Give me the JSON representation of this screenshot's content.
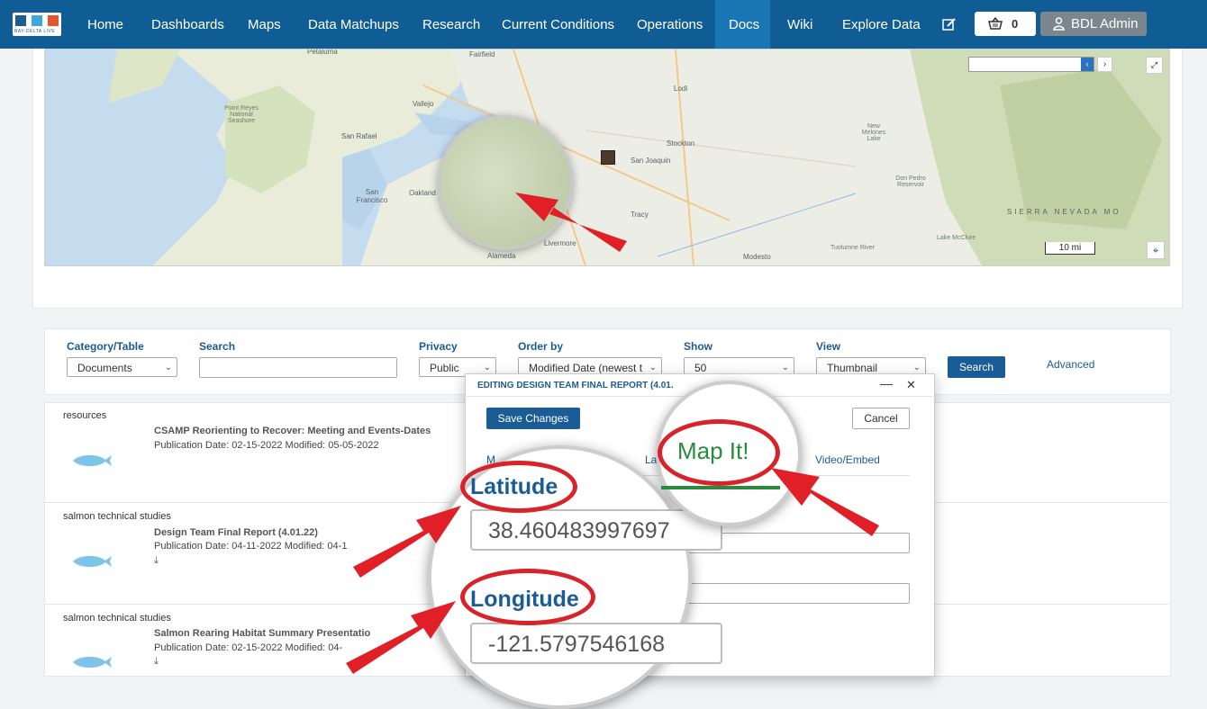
{
  "nav": {
    "items": [
      "Home",
      "Dashboards",
      "Maps",
      "Data Matchups",
      "Research",
      "Current Conditions",
      "Operations",
      "Docs",
      "Wiki",
      "Explore Data"
    ],
    "active": "Docs",
    "logo_text": "BAY-DELTA LIVE",
    "cart_count": "0",
    "user_label": "BDL Admin",
    "brand_color": "#0f5d94"
  },
  "map": {
    "labels": [
      "Petaluma",
      "Fairfield",
      "Lodi",
      "Vallejo",
      "Point Reyes National Seashore",
      "San Rafael",
      "Stockton",
      "New Melones Lake",
      "San Joaquin",
      "San Francisco",
      "Oakland",
      "Tracy",
      "Don Pedro Reservoir",
      "Livermore",
      "Alameda",
      "Modesto",
      "SIERRA NEVADA MO",
      "Tuolumne River",
      "Lake McClure"
    ],
    "scale": "10 mi"
  },
  "filters": {
    "category_label": "Category/Table",
    "category_value": "Documents",
    "search_label": "Search",
    "search_value": "",
    "privacy_label": "Privacy",
    "privacy_value": "Public",
    "order_label": "Order by",
    "order_value": "Modified Date (newest t",
    "show_label": "Show",
    "show_value": "50",
    "view_label": "View",
    "view_value": "Thumbnail",
    "search_button": "Search",
    "advanced_link": "Advanced"
  },
  "results": [
    {
      "category": "resources",
      "title": "CSAMP Reorienting to Recover: Meeting and Events-Dates",
      "dates": "Publication Date: 02-15-2022 Modified: 05-05-2022"
    },
    {
      "category": "salmon technical studies",
      "title": "Design Team Final Report (4.01.22)",
      "dates": "Publication Date: 04-11-2022 Modified: 04-1"
    },
    {
      "category": "salmon technical studies",
      "title": "Salmon Rearing Habitat Summary Presentatio",
      "dates": "Publication Date: 02-15-2022 Modified: 04-"
    }
  ],
  "modal": {
    "title": "EDITING DESIGN TEAM FINAL REPORT (4.01.",
    "save_button": "Save Changes",
    "cancel_button": "Cancel",
    "tabs": [
      "M",
      "La",
      "Video/Embed"
    ],
    "map_it_tab": "Map It!",
    "latitude_label": "Latitude",
    "latitude_value": "38.460483997697",
    "longitude_label": "Longitude",
    "longitude_value": "-121.5797546168"
  },
  "colors": {
    "accent": "#1a5c96",
    "highlight": "#d8232a",
    "map_it_green": "#2a8a3e"
  }
}
